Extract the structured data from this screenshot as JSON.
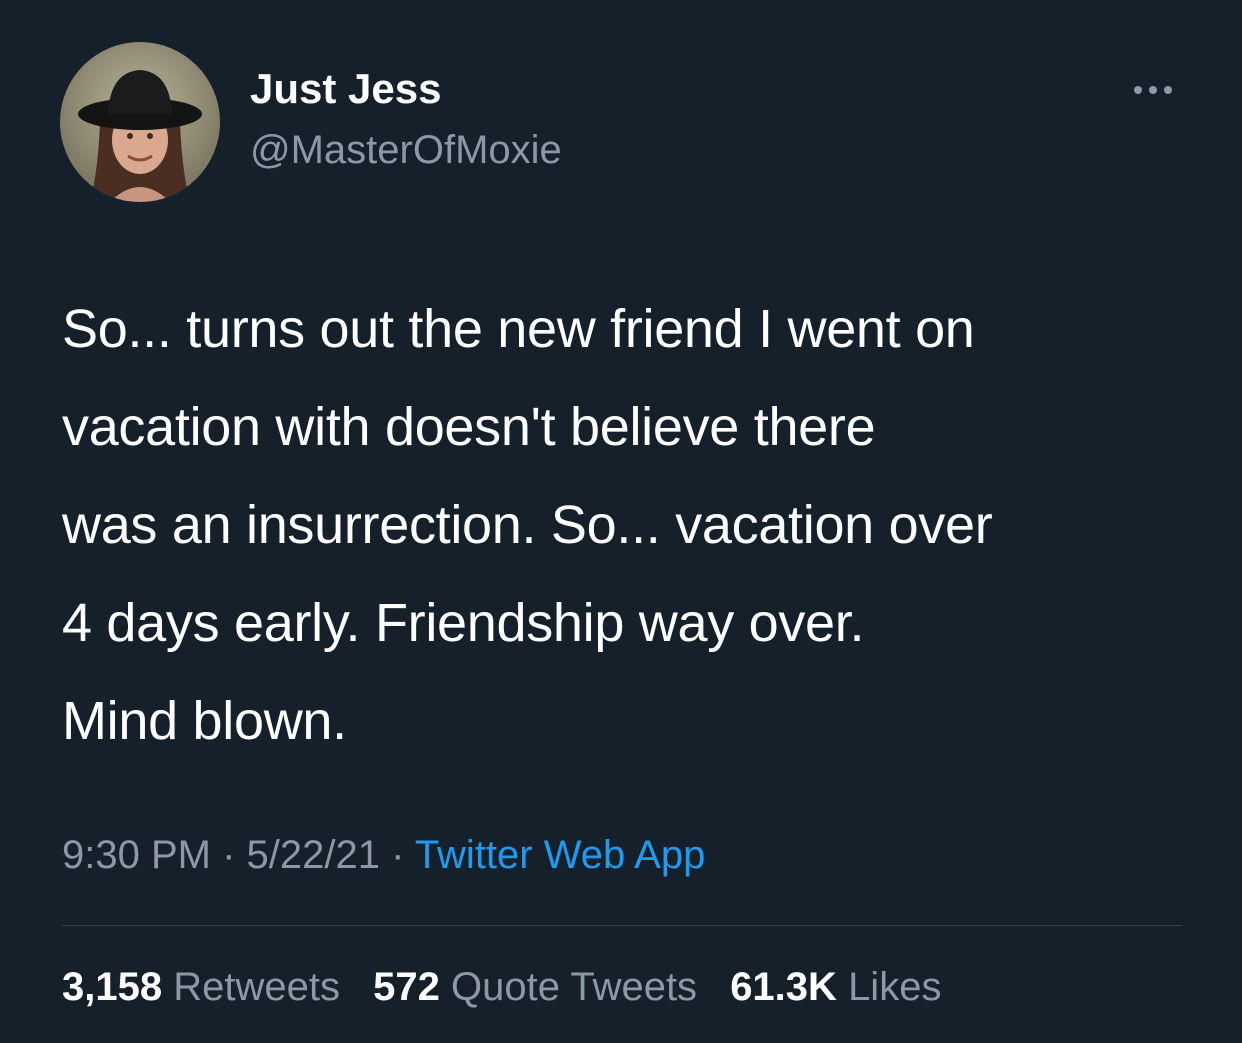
{
  "author": {
    "display_name": "Just Jess",
    "handle": "@MasterOfMoxie"
  },
  "tweet": {
    "lines": [
      "So... turns out the new friend I went on",
      "vacation with doesn't believe there",
      "was an insurrection. So... vacation over",
      "4 days early. Friendship way over.",
      "Mind blown."
    ]
  },
  "meta": {
    "time": "9:30 PM",
    "separator": " · ",
    "date": "5/22/21",
    "source": "Twitter Web App"
  },
  "stats": {
    "retweets": {
      "count": "3,158",
      "label": "Retweets"
    },
    "quote_tweets": {
      "count": "572",
      "label": "Quote Tweets"
    },
    "likes": {
      "count": "61.3K",
      "label": "Likes"
    }
  },
  "icons": {
    "more": "more-horizontal-icon"
  },
  "colors": {
    "background": "#15202b",
    "text_primary": "#ffffff",
    "text_secondary": "#8b98a5",
    "link": "#1d9bf0",
    "divider": "#38444d"
  }
}
